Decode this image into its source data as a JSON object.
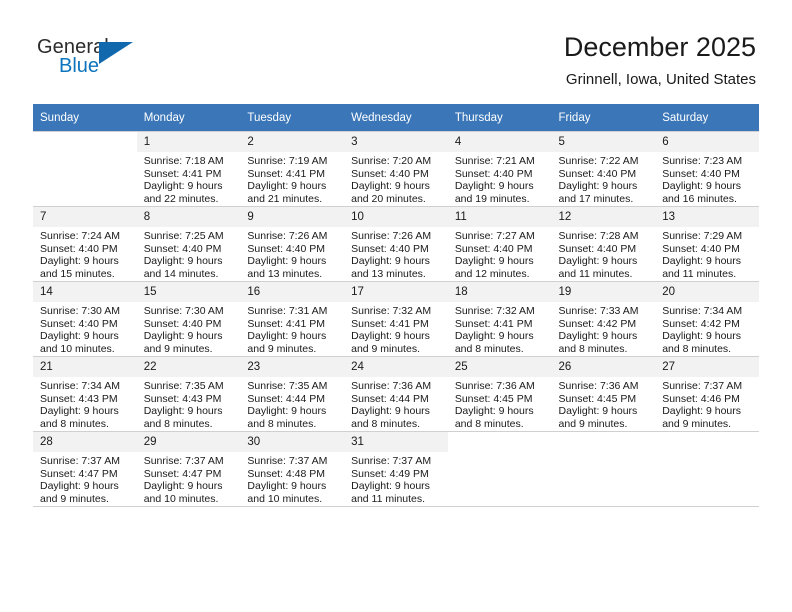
{
  "brand": {
    "name_part1": "General",
    "name_part2": "Blue",
    "triangle_color": "#1168ad",
    "blue_text_color": "#0d74bd"
  },
  "header": {
    "title": "December 2025",
    "location": "Grinnell, Iowa, United States"
  },
  "theme": {
    "header_blue": "#3a76b8",
    "daynum_bg": "#f2f2f2",
    "grid_line": "#d0d0d0"
  },
  "weekday_headers": [
    "Sunday",
    "Monday",
    "Tuesday",
    "Wednesday",
    "Thursday",
    "Friday",
    "Saturday"
  ],
  "labels": {
    "sunrise_prefix": "Sunrise:",
    "sunset_prefix": "Sunset:",
    "daylight_prefix": "Daylight:"
  },
  "weeks": [
    [
      {
        "day": "",
        "blank": true
      },
      {
        "day": "1",
        "line1": "Sunrise: 7:18 AM",
        "line2": "Sunset: 4:41 PM",
        "line3": "Daylight: 9 hours",
        "line4": "and 22 minutes."
      },
      {
        "day": "2",
        "line1": "Sunrise: 7:19 AM",
        "line2": "Sunset: 4:41 PM",
        "line3": "Daylight: 9 hours",
        "line4": "and 21 minutes."
      },
      {
        "day": "3",
        "line1": "Sunrise: 7:20 AM",
        "line2": "Sunset: 4:40 PM",
        "line3": "Daylight: 9 hours",
        "line4": "and 20 minutes."
      },
      {
        "day": "4",
        "line1": "Sunrise: 7:21 AM",
        "line2": "Sunset: 4:40 PM",
        "line3": "Daylight: 9 hours",
        "line4": "and 19 minutes."
      },
      {
        "day": "5",
        "line1": "Sunrise: 7:22 AM",
        "line2": "Sunset: 4:40 PM",
        "line3": "Daylight: 9 hours",
        "line4": "and 17 minutes."
      },
      {
        "day": "6",
        "line1": "Sunrise: 7:23 AM",
        "line2": "Sunset: 4:40 PM",
        "line3": "Daylight: 9 hours",
        "line4": "and 16 minutes."
      }
    ],
    [
      {
        "day": "7",
        "line1": "Sunrise: 7:24 AM",
        "line2": "Sunset: 4:40 PM",
        "line3": "Daylight: 9 hours",
        "line4": "and 15 minutes."
      },
      {
        "day": "8",
        "line1": "Sunrise: 7:25 AM",
        "line2": "Sunset: 4:40 PM",
        "line3": "Daylight: 9 hours",
        "line4": "and 14 minutes."
      },
      {
        "day": "9",
        "line1": "Sunrise: 7:26 AM",
        "line2": "Sunset: 4:40 PM",
        "line3": "Daylight: 9 hours",
        "line4": "and 13 minutes."
      },
      {
        "day": "10",
        "line1": "Sunrise: 7:26 AM",
        "line2": "Sunset: 4:40 PM",
        "line3": "Daylight: 9 hours",
        "line4": "and 13 minutes."
      },
      {
        "day": "11",
        "line1": "Sunrise: 7:27 AM",
        "line2": "Sunset: 4:40 PM",
        "line3": "Daylight: 9 hours",
        "line4": "and 12 minutes."
      },
      {
        "day": "12",
        "line1": "Sunrise: 7:28 AM",
        "line2": "Sunset: 4:40 PM",
        "line3": "Daylight: 9 hours",
        "line4": "and 11 minutes."
      },
      {
        "day": "13",
        "line1": "Sunrise: 7:29 AM",
        "line2": "Sunset: 4:40 PM",
        "line3": "Daylight: 9 hours",
        "line4": "and 11 minutes."
      }
    ],
    [
      {
        "day": "14",
        "line1": "Sunrise: 7:30 AM",
        "line2": "Sunset: 4:40 PM",
        "line3": "Daylight: 9 hours",
        "line4": "and 10 minutes."
      },
      {
        "day": "15",
        "line1": "Sunrise: 7:30 AM",
        "line2": "Sunset: 4:40 PM",
        "line3": "Daylight: 9 hours",
        "line4": "and 9 minutes."
      },
      {
        "day": "16",
        "line1": "Sunrise: 7:31 AM",
        "line2": "Sunset: 4:41 PM",
        "line3": "Daylight: 9 hours",
        "line4": "and 9 minutes."
      },
      {
        "day": "17",
        "line1": "Sunrise: 7:32 AM",
        "line2": "Sunset: 4:41 PM",
        "line3": "Daylight: 9 hours",
        "line4": "and 9 minutes."
      },
      {
        "day": "18",
        "line1": "Sunrise: 7:32 AM",
        "line2": "Sunset: 4:41 PM",
        "line3": "Daylight: 9 hours",
        "line4": "and 8 minutes."
      },
      {
        "day": "19",
        "line1": "Sunrise: 7:33 AM",
        "line2": "Sunset: 4:42 PM",
        "line3": "Daylight: 9 hours",
        "line4": "and 8 minutes."
      },
      {
        "day": "20",
        "line1": "Sunrise: 7:34 AM",
        "line2": "Sunset: 4:42 PM",
        "line3": "Daylight: 9 hours",
        "line4": "and 8 minutes."
      }
    ],
    [
      {
        "day": "21",
        "line1": "Sunrise: 7:34 AM",
        "line2": "Sunset: 4:43 PM",
        "line3": "Daylight: 9 hours",
        "line4": "and 8 minutes."
      },
      {
        "day": "22",
        "line1": "Sunrise: 7:35 AM",
        "line2": "Sunset: 4:43 PM",
        "line3": "Daylight: 9 hours",
        "line4": "and 8 minutes."
      },
      {
        "day": "23",
        "line1": "Sunrise: 7:35 AM",
        "line2": "Sunset: 4:44 PM",
        "line3": "Daylight: 9 hours",
        "line4": "and 8 minutes."
      },
      {
        "day": "24",
        "line1": "Sunrise: 7:36 AM",
        "line2": "Sunset: 4:44 PM",
        "line3": "Daylight: 9 hours",
        "line4": "and 8 minutes."
      },
      {
        "day": "25",
        "line1": "Sunrise: 7:36 AM",
        "line2": "Sunset: 4:45 PM",
        "line3": "Daylight: 9 hours",
        "line4": "and 8 minutes."
      },
      {
        "day": "26",
        "line1": "Sunrise: 7:36 AM",
        "line2": "Sunset: 4:45 PM",
        "line3": "Daylight: 9 hours",
        "line4": "and 9 minutes."
      },
      {
        "day": "27",
        "line1": "Sunrise: 7:37 AM",
        "line2": "Sunset: 4:46 PM",
        "line3": "Daylight: 9 hours",
        "line4": "and 9 minutes."
      }
    ],
    [
      {
        "day": "28",
        "line1": "Sunrise: 7:37 AM",
        "line2": "Sunset: 4:47 PM",
        "line3": "Daylight: 9 hours",
        "line4": "and 9 minutes."
      },
      {
        "day": "29",
        "line1": "Sunrise: 7:37 AM",
        "line2": "Sunset: 4:47 PM",
        "line3": "Daylight: 9 hours",
        "line4": "and 10 minutes."
      },
      {
        "day": "30",
        "line1": "Sunrise: 7:37 AM",
        "line2": "Sunset: 4:48 PM",
        "line3": "Daylight: 9 hours",
        "line4": "and 10 minutes."
      },
      {
        "day": "31",
        "line1": "Sunrise: 7:37 AM",
        "line2": "Sunset: 4:49 PM",
        "line3": "Daylight: 9 hours",
        "line4": "and 11 minutes."
      },
      {
        "day": "",
        "blank": true
      },
      {
        "day": "",
        "blank": true
      },
      {
        "day": "",
        "blank": true
      }
    ]
  ]
}
